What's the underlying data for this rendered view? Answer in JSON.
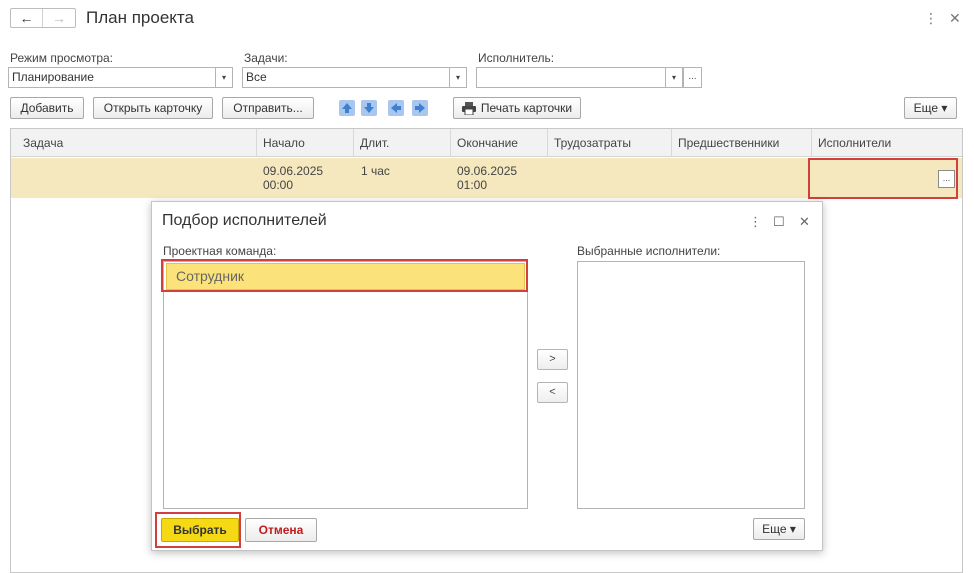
{
  "header": {
    "title": "План проекта",
    "back_icon": "←",
    "forward_icon": "→",
    "more_icon": "⋮",
    "close_icon": "✕"
  },
  "filters": {
    "mode_label": "Режим просмотра:",
    "mode_value": "Планирование",
    "tasks_label": "Задачи:",
    "tasks_value": "Все",
    "executor_label": "Исполнитель:",
    "executor_value": "",
    "dropdown_icon": "▾",
    "dots": "..."
  },
  "toolbar": {
    "add": "Добавить",
    "open_card": "Открыть карточку",
    "send": "Отправить...",
    "print_card": "Печать карточки",
    "more": "Еще ▾",
    "arrow_icons": [
      "arrow-up-icon",
      "arrow-down-icon",
      "arrow-left-icon",
      "arrow-right-icon"
    ]
  },
  "table": {
    "columns": [
      "Задача",
      "Начало",
      "Длит.",
      "Окончание",
      "Трудозатраты",
      "Предшественники",
      "Исполнители"
    ],
    "rows": [
      {
        "task": "",
        "start_date": "09.06.2025",
        "start_time": "00:00",
        "duration": "1 час",
        "end_date": "09.06.2025",
        "end_time": "01:00",
        "labor": "",
        "predecessors": "",
        "executors": "",
        "select_button": "..."
      }
    ]
  },
  "dialog": {
    "title": "Подбор исполнителей",
    "team_label": "Проектная команда:",
    "team_items": [
      "Сотрудник"
    ],
    "selected_label": "Выбранные исполнители:",
    "add_arrow": ">",
    "remove_arrow": "<",
    "select_button": "Выбрать",
    "cancel_button": "Отмена",
    "more_button": "Еще ▾",
    "more_icon": "⋮",
    "maximize_icon": "☐",
    "close_icon": "✕"
  },
  "colors": {
    "row_highlight": "#f5e8be",
    "team_item_bg": "#fbe27a",
    "select_button": "#f5d914",
    "annotation_border": "#d23f3f"
  }
}
